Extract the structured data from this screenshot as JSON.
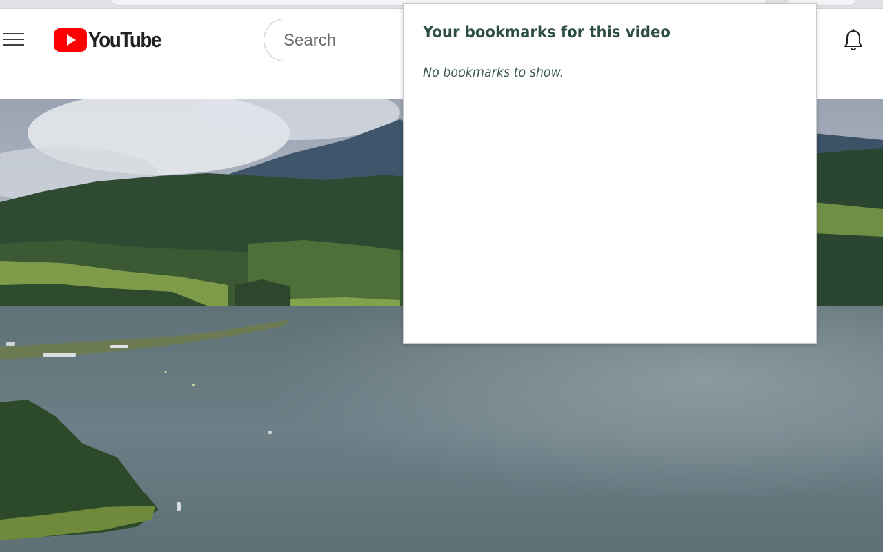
{
  "header": {
    "logo_text": "YouTube",
    "search_placeholder": "Search"
  },
  "bookmarks_popup": {
    "title": "Your bookmarks for this video",
    "empty_message": "No bookmarks to show."
  },
  "icons": {
    "menu": "hamburger-menu-icon",
    "logo": "youtube-play-logo",
    "notifications": "bell-icon"
  },
  "colors": {
    "youtube_red": "#ff0000",
    "popup_heading": "#2d4f43",
    "popup_text": "#3e5a50"
  }
}
